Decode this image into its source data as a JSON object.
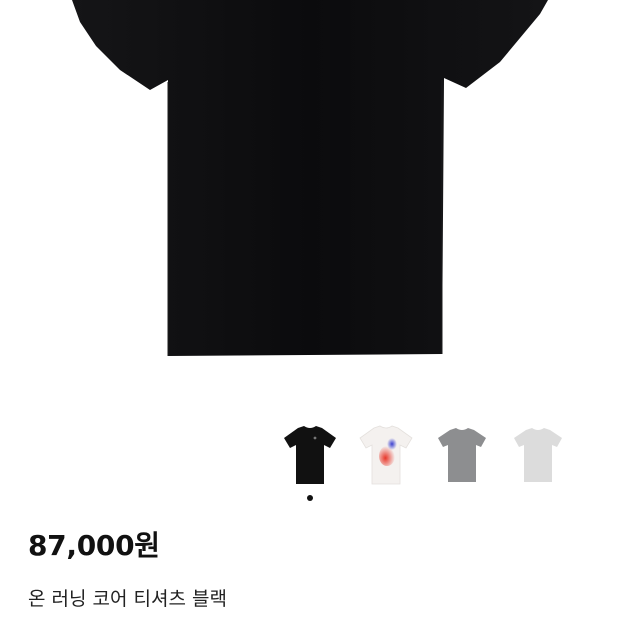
{
  "product": {
    "price": "87,000원",
    "name": "온 러닝 코어 티셔츠 블랙"
  },
  "colors": {
    "hero_shirt": "#0c0c0e",
    "thumb_black": "#111111",
    "thumb_white": "#f4f1ef",
    "thumb_grey": "#8d8e90",
    "thumb_light_grey": "#dcdcdc",
    "indicator": "#111111"
  },
  "gallery": {
    "thumbnails": [
      {
        "label": "black-tshirt"
      },
      {
        "label": "white-print-tshirt"
      },
      {
        "label": "grey-tshirt"
      },
      {
        "label": "light-grey-tshirt"
      }
    ],
    "active_index": 0
  }
}
